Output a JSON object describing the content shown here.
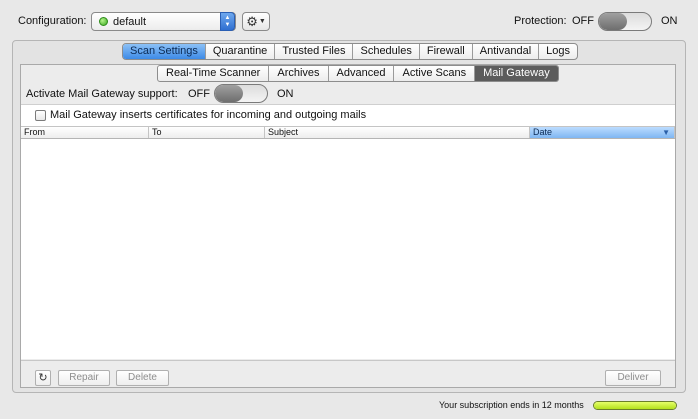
{
  "header": {
    "configuration_label": "Configuration:",
    "configuration_value": "default",
    "protection_label": "Protection:",
    "protection_off": "OFF",
    "protection_on": "ON"
  },
  "main_tabs": [
    {
      "label": "Scan Settings",
      "active": true
    },
    {
      "label": "Quarantine",
      "active": false
    },
    {
      "label": "Trusted Files",
      "active": false
    },
    {
      "label": "Schedules",
      "active": false
    },
    {
      "label": "Firewall",
      "active": false
    },
    {
      "label": "Antivandal",
      "active": false
    },
    {
      "label": "Logs",
      "active": false
    }
  ],
  "sub_tabs": [
    {
      "label": "Real-Time Scanner",
      "active": false
    },
    {
      "label": "Archives",
      "active": false
    },
    {
      "label": "Advanced",
      "active": false
    },
    {
      "label": "Active Scans",
      "active": false
    },
    {
      "label": "Mail Gateway",
      "active": true
    }
  ],
  "gateway": {
    "activate_label": "Activate Mail Gateway support:",
    "off": "OFF",
    "on": "ON",
    "certificate_label": "Mail Gateway inserts certificates for incoming and outgoing mails"
  },
  "table": {
    "columns": [
      {
        "label": "From",
        "sorted": false
      },
      {
        "label": "To",
        "sorted": false
      },
      {
        "label": "Subject",
        "sorted": false
      },
      {
        "label": "Date",
        "sorted": true
      }
    ]
  },
  "buttons": {
    "repair": "Repair",
    "delete": "Delete",
    "deliver": "Deliver"
  },
  "footer": {
    "subscription_text": "Your subscription ends in 12 months",
    "subscription_fraction": 1.0
  },
  "colors": {
    "active_tab": "#3d8ae6",
    "active_subtab": "#5c5c5c",
    "status_green": "#3aa820",
    "subscription_bar": "#b3e21c"
  }
}
